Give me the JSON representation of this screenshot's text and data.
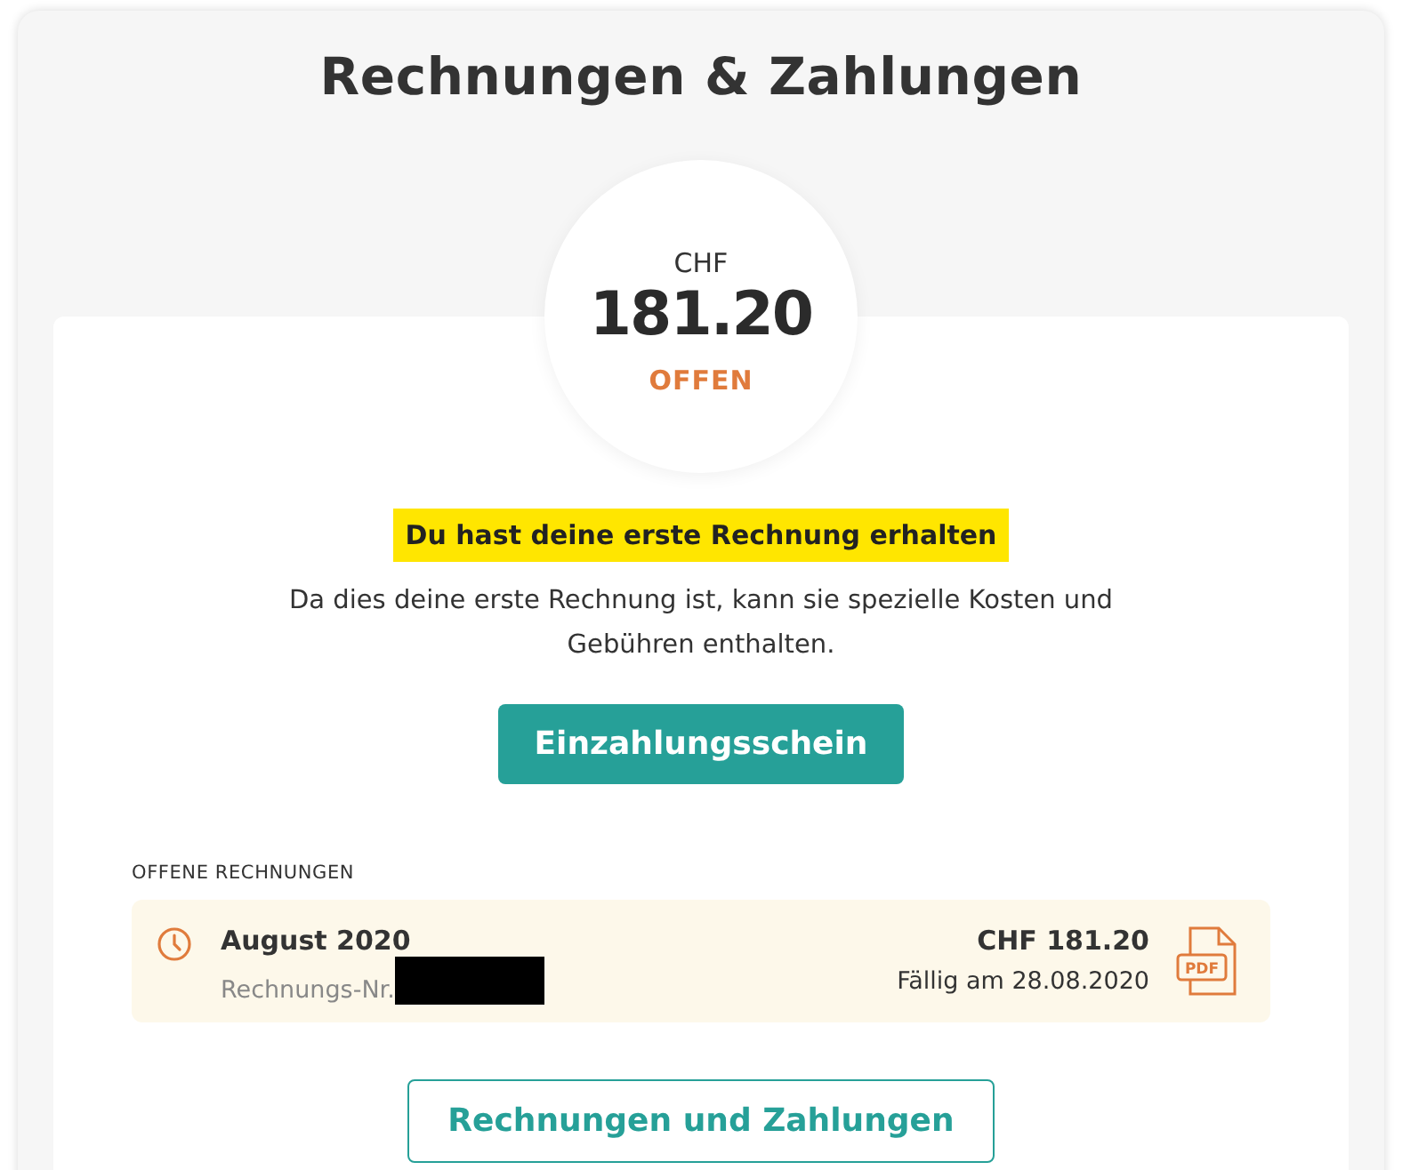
{
  "title": "Rechnungen & Zahlungen",
  "balance": {
    "currency": "CHF",
    "amount": "181.20",
    "status": "OFFEN"
  },
  "notice": {
    "heading": "Du hast deine erste Rechnung erhalten",
    "text": "Da dies deine erste Rechnung ist, kann sie spezielle Kosten und Gebühren enthalten."
  },
  "primary_button": "Einzahlungsschein",
  "open_invoices": {
    "label": "OFFENE RECHNUNGEN",
    "items": [
      {
        "month": "August 2020",
        "number_label": "Rechnungs-Nr.",
        "amount": "CHF 181.20",
        "due": "Fällig am 28.08.2020",
        "file_type": "PDF"
      }
    ]
  },
  "secondary_button": "Rechnungen und Zahlungen"
}
